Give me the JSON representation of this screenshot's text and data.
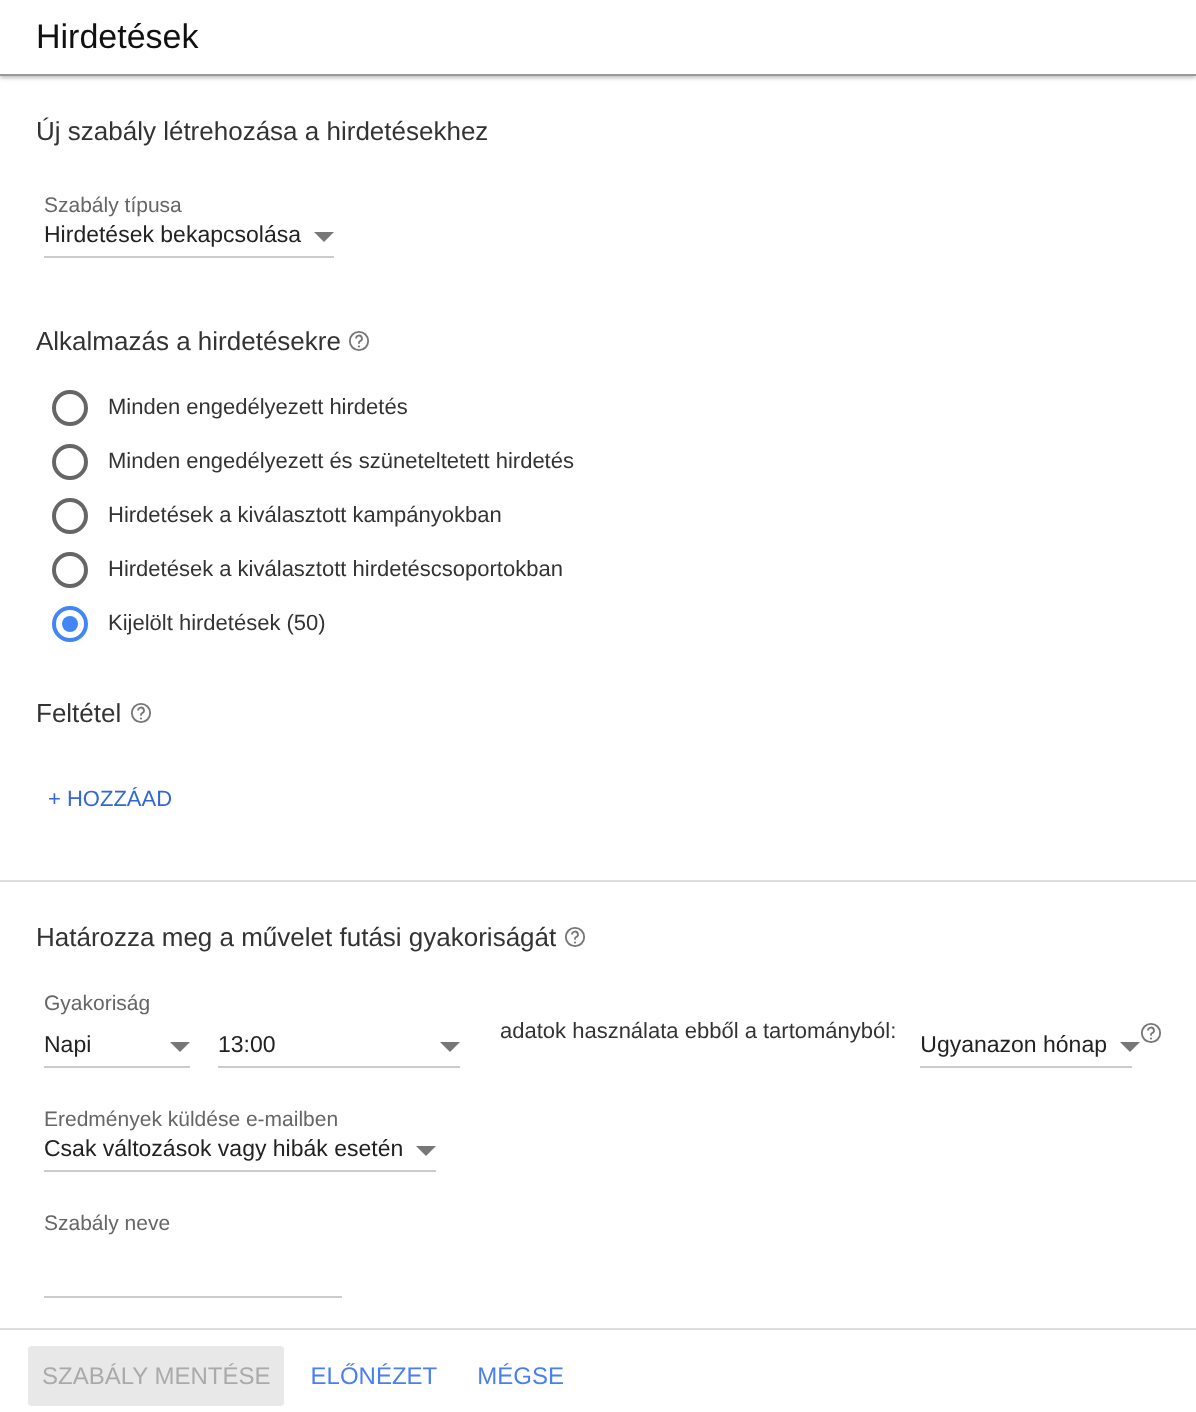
{
  "header": {
    "title": "Hirdetések"
  },
  "section_title": "Új szabály létrehozása a hirdetésekhez",
  "rule_type": {
    "label": "Szabály típusa",
    "value": "Hirdetések bekapcsolása"
  },
  "apply": {
    "title": "Alkalmazás a hirdetésekre",
    "options": [
      {
        "label": "Minden engedélyezett hirdetés",
        "selected": false
      },
      {
        "label": "Minden engedélyezett és szüneteltetett hirdetés",
        "selected": false
      },
      {
        "label": "Hirdetések a kiválasztott kampányokban",
        "selected": false
      },
      {
        "label": "Hirdetések a kiválasztott hirdetéscsoportokban",
        "selected": false
      },
      {
        "label": "Kijelölt hirdetések (50)",
        "selected": true
      }
    ]
  },
  "condition": {
    "title": "Feltétel",
    "add": "+ HOZZÁAD"
  },
  "frequency": {
    "title": "Határozza meg a művelet futási gyakoriságát",
    "label": "Gyakoriság",
    "period": "Napi",
    "time": "13:00",
    "range_label": "adatok használata ebből a tartományból:",
    "range": "Ugyanazon hónap"
  },
  "email": {
    "label": "Eredmények küldése e-mailben",
    "value": "Csak változások vagy hibák esetén"
  },
  "name": {
    "label": "Szabály neve"
  },
  "buttons": [
    {
      "label": "SZABÁLY MENTÉSE",
      "disabled": true
    },
    {
      "label": "ELŐNÉZET",
      "disabled": false
    },
    {
      "label": "MÉGSE",
      "disabled": false
    }
  ]
}
